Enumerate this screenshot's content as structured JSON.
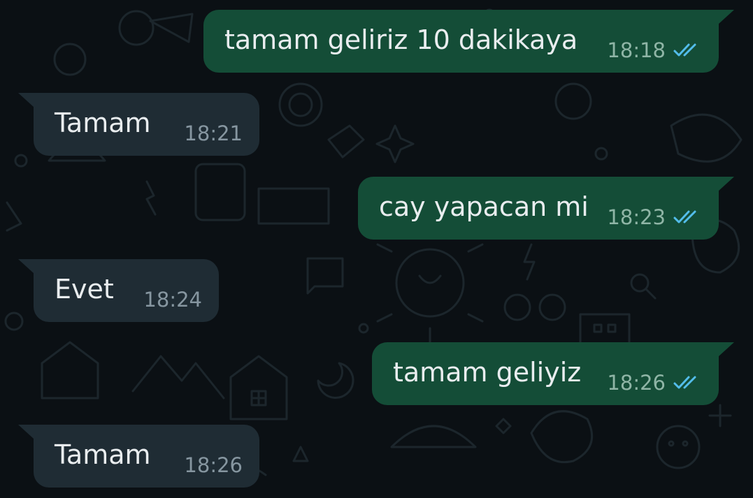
{
  "colors": {
    "background": "#0b1014",
    "outgoing_bubble": "#144d37",
    "incoming_bubble": "#1f2c34",
    "text": "#e9edef",
    "timestamp": "#8696a0",
    "read_receipt": "#53bdeb"
  },
  "messages": [
    {
      "direction": "outgoing",
      "text": "tamam geliriz 10 dakikaya",
      "time": "18:18",
      "status": "read",
      "status_icon": "double-check-icon"
    },
    {
      "direction": "incoming",
      "text": "Tamam",
      "time": "18:21"
    },
    {
      "direction": "outgoing",
      "text": "cay yapacan mi",
      "time": "18:23",
      "status": "read",
      "status_icon": "double-check-icon"
    },
    {
      "direction": "incoming",
      "text": "Evet",
      "time": "18:24"
    },
    {
      "direction": "outgoing",
      "text": "tamam geliyiz",
      "time": "18:26",
      "status": "read",
      "status_icon": "double-check-icon"
    },
    {
      "direction": "incoming",
      "text": "Tamam",
      "time": "18:26"
    }
  ]
}
